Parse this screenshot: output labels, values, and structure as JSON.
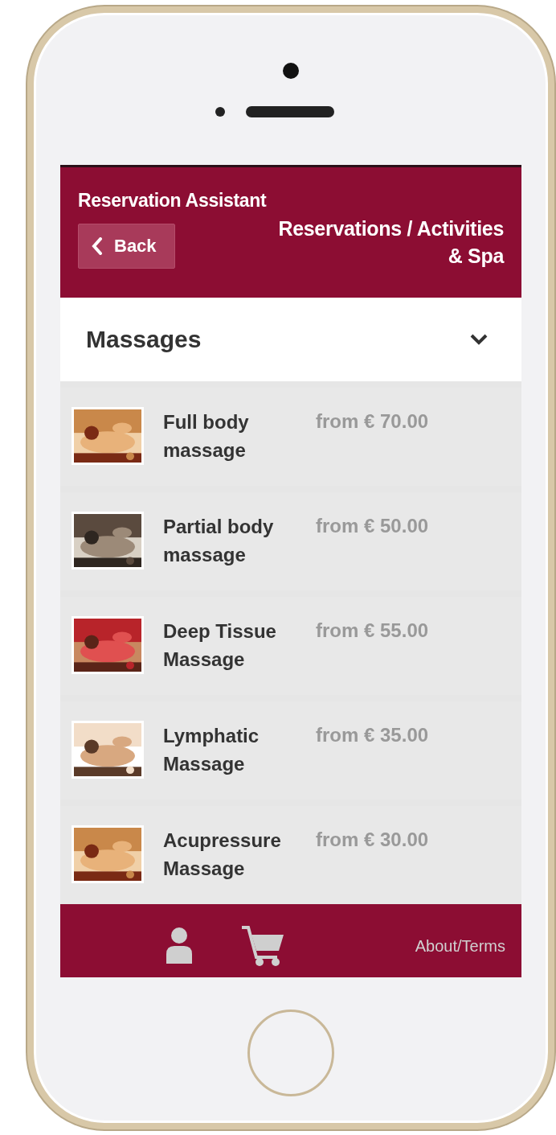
{
  "header": {
    "app_title": "Reservation Assistant",
    "back_button": "Back",
    "page_title": "Reservations / Activities & Spa"
  },
  "category": {
    "label": "Massages",
    "expanded": false
  },
  "services": [
    {
      "name": "Full body massage",
      "price": "from € 70.00"
    },
    {
      "name": "Partial body massage",
      "price": "from € 50.00"
    },
    {
      "name": "Deep Tissue Massage",
      "price": "from € 55.00"
    },
    {
      "name": "Lymphatic Massage",
      "price": "from € 35.00"
    },
    {
      "name": "Acupressure Massage",
      "price": "from € 30.00"
    }
  ],
  "bottom_bar": {
    "link": "About/Terms"
  }
}
